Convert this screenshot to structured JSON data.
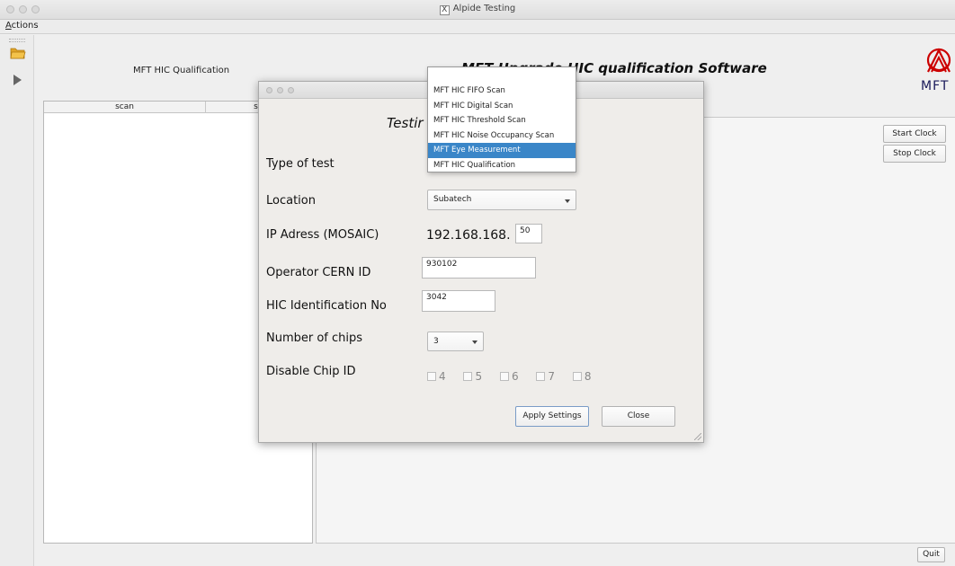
{
  "window": {
    "title": "Alpide Testing"
  },
  "menubar": {
    "actions_label": "Actions"
  },
  "header": {
    "left_label": "MFT HIC Qualification",
    "title": "MFT Upgrade HIC qualification Software",
    "logo_text": "MFT"
  },
  "scan_table": {
    "columns": [
      "scan",
      "sta"
    ]
  },
  "side_buttons": {
    "start_clock": "Start Clock",
    "stop_clock": "Stop Clock",
    "quit": "Quit"
  },
  "dialog": {
    "heading": "Testir",
    "labels": {
      "type_of_test": "Type of test",
      "location": "Location",
      "ip_address": "IP Adress (MOSAIC)",
      "operator_id": "Operator CERN ID",
      "hic_id": "HIC Identification No",
      "num_chips": "Number of chips",
      "disable_chip": "Disable Chip ID"
    },
    "values": {
      "location": "Subatech",
      "ip_prefix": "192.168.168.",
      "ip_last": "50",
      "operator_id": "930102",
      "hic_id": "3042",
      "num_chips": "3"
    },
    "chip_checkboxes": [
      "4",
      "5",
      "6",
      "7",
      "8"
    ],
    "apply_label": "Apply Settings",
    "close_label": "Close"
  },
  "test_dropdown": {
    "options": [
      "MFT HIC FIFO Scan",
      "MFT HIC Digital Scan",
      "MFT HIC Threshold Scan",
      "MFT HIC Noise Occupancy Scan",
      "MFT Eye Measurement",
      "MFT HIC Qualification"
    ],
    "selected_index": 4
  },
  "colors": {
    "selection": "#3a86c8",
    "logo": "#cc0000"
  }
}
